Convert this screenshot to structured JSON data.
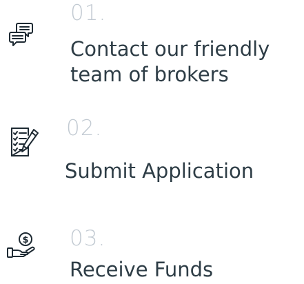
{
  "steps": [
    {
      "number": "01.",
      "title_lines": [
        "Contact our friendly",
        "team of brokers"
      ],
      "icon": "chat-bubbles-icon"
    },
    {
      "number": "02.",
      "title_lines": [
        "Submit Application"
      ],
      "icon": "checklist-pen-icon"
    },
    {
      "number": "03.",
      "title_lines": [
        "Receive Funds"
      ],
      "icon": "hand-coin-icon"
    }
  ],
  "colors": {
    "number": "#c2cad2",
    "title": "#2e3d46",
    "icon": "#1e2a33"
  }
}
